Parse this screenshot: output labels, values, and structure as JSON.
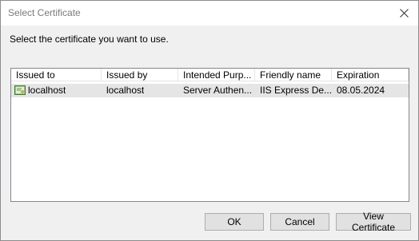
{
  "window": {
    "title": "Select Certificate"
  },
  "prompt": "Select the certificate you want to use.",
  "columns": [
    "Issued to",
    "Issued by",
    "Intended Purp...",
    "Friendly name",
    "Expiration"
  ],
  "rows": [
    {
      "icon": "certificate-icon",
      "issued_to": "localhost",
      "issued_by": "localhost",
      "intended_purpose": "Server Authen...",
      "friendly_name": "IIS Express De...",
      "expiration": "08.05.2024"
    }
  ],
  "buttons": {
    "ok": "OK",
    "cancel": "Cancel",
    "view_certificate": "View Certificate"
  }
}
